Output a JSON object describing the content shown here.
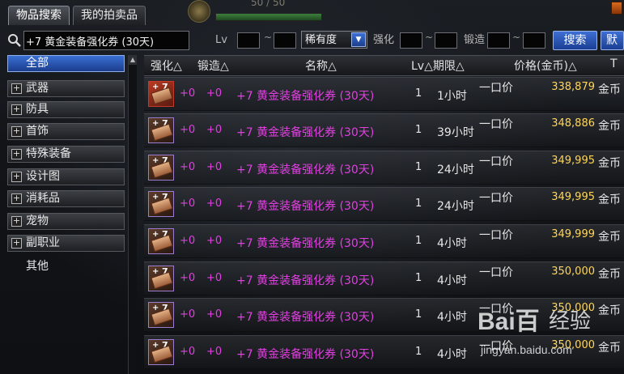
{
  "tabs": [
    {
      "label": "物品搜索",
      "active": true
    },
    {
      "label": "我的拍卖品",
      "active": false
    }
  ],
  "top_hud": {
    "hp_text": "50 / 50"
  },
  "search": {
    "value": "+7 黄金装备强化券 (30天)",
    "lv_label": "Lv",
    "lv_min": "",
    "lv_max": "",
    "tilde": "~",
    "rarity_selected": "稀有度",
    "enhance_label": "强化",
    "enhance_min": "",
    "enhance_max": "",
    "forge_label": "锻造",
    "forge_min": "",
    "forge_max": "",
    "search_button": "搜索",
    "next_button": "默"
  },
  "sidebar": {
    "items": [
      {
        "label": "全部",
        "expandable": false,
        "selected": true
      },
      {
        "label": "武器",
        "expandable": true,
        "selected": false
      },
      {
        "label": "防具",
        "expandable": true,
        "selected": false
      },
      {
        "label": "首饰",
        "expandable": true,
        "selected": false
      },
      {
        "label": "特殊装备",
        "expandable": true,
        "selected": false
      },
      {
        "label": "设计图",
        "expandable": true,
        "selected": false
      },
      {
        "label": "消耗品",
        "expandable": true,
        "selected": false
      },
      {
        "label": "宠物",
        "expandable": true,
        "selected": false
      },
      {
        "label": "副职业",
        "expandable": true,
        "selected": false
      },
      {
        "label": "其他",
        "expandable": false,
        "selected": false
      }
    ],
    "plus_glyph": "+",
    "scroll_up_glyph": "▲"
  },
  "columns": {
    "enhance": "强化△",
    "forge": "锻造△",
    "name": "名称△",
    "lv_period": "Lv△期限△",
    "price": "价格(金币)△",
    "extra": "T"
  },
  "rows": [
    {
      "enhance": "+0",
      "forge": "+0",
      "name": "+7 黄金装备强化券 (30天)",
      "lv": "1",
      "time": "1小时",
      "price_type": "一口价",
      "price": "338,879",
      "unit": "金币",
      "highlight": true
    },
    {
      "enhance": "+0",
      "forge": "+0",
      "name": "+7 黄金装备强化券 (30天)",
      "lv": "1",
      "time": "39小时",
      "price_type": "一口价",
      "price": "348,886",
      "unit": "金币",
      "highlight": false
    },
    {
      "enhance": "+0",
      "forge": "+0",
      "name": "+7 黄金装备强化券 (30天)",
      "lv": "1",
      "time": "24小时",
      "price_type": "一口价",
      "price": "349,995",
      "unit": "金币",
      "highlight": false
    },
    {
      "enhance": "+0",
      "forge": "+0",
      "name": "+7 黄金装备强化券 (30天)",
      "lv": "1",
      "time": "24小时",
      "price_type": "一口价",
      "price": "349,995",
      "unit": "金币",
      "highlight": false
    },
    {
      "enhance": "+0",
      "forge": "+0",
      "name": "+7 黄金装备强化券 (30天)",
      "lv": "1",
      "time": "4小时",
      "price_type": "一口价",
      "price": "349,999",
      "unit": "金币",
      "highlight": false
    },
    {
      "enhance": "+0",
      "forge": "+0",
      "name": "+7 黄金装备强化券 (30天)",
      "lv": "1",
      "time": "4小时",
      "price_type": "一口价",
      "price": "350,000",
      "unit": "金币",
      "highlight": false
    },
    {
      "enhance": "+0",
      "forge": "+0",
      "name": "+7 黄金装备强化券 (30天)",
      "lv": "1",
      "time": "4小时",
      "price_type": "一口价",
      "price": "350,000",
      "unit": "金币",
      "highlight": false
    },
    {
      "enhance": "+0",
      "forge": "+0",
      "name": "+7 黄金装备强化券 (30天)",
      "lv": "1",
      "time": "4小时",
      "price_type": "一口价",
      "price": "350,000",
      "unit": "金币",
      "highlight": false
    }
  ],
  "icon_glyph": {
    "star": "+",
    "seven": "7"
  },
  "watermark": {
    "logo": "Bai百",
    "tag": "经验",
    "url": "jingyan.baidu.com"
  },
  "colors": {
    "item_name": "#e040e0",
    "price": "#ffd65a",
    "selected_blue": "#3a6fd4"
  }
}
